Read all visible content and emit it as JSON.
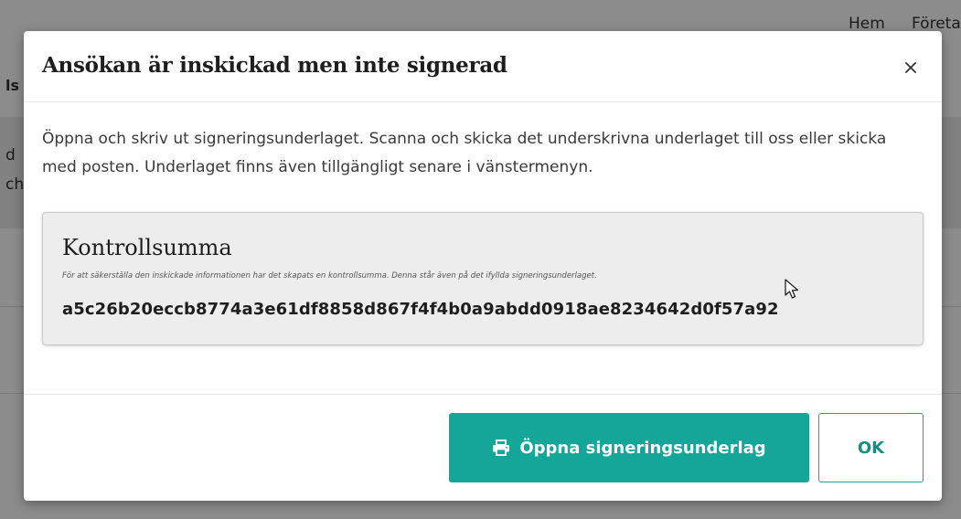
{
  "background": {
    "nav_items": [
      "Hem",
      "Företag"
    ],
    "left_fragments": [
      "ls",
      "d",
      "ch"
    ]
  },
  "modal": {
    "title": "Ansökan är inskickad men inte signerad",
    "close_icon": "close-icon",
    "body_text": "Öppna och skriv ut signeringsunderlaget. Scanna och skicka det underskrivna underlaget till oss eller skicka med posten. Underlaget finns även tillgängligt senare i vänstermenyn.",
    "checksum": {
      "title": "Kontrollsumma",
      "description": "För att säkerställa den inskickade informationen har det skapats en kontrollsumma. Denna står även på det ifyllda signeringsunderlaget.",
      "value": "a5c26b20eccb8774a3e61df8858d867f4f4b0a9abdd0918ae8234642d0f57a92"
    },
    "primary_button": {
      "label": "Öppna signeringsunderlag",
      "icon": "printer-icon"
    },
    "ok_button": {
      "label": "OK"
    }
  },
  "colors": {
    "accent": "#15a69a",
    "overlay": "rgba(0,0,0,0.45)"
  }
}
